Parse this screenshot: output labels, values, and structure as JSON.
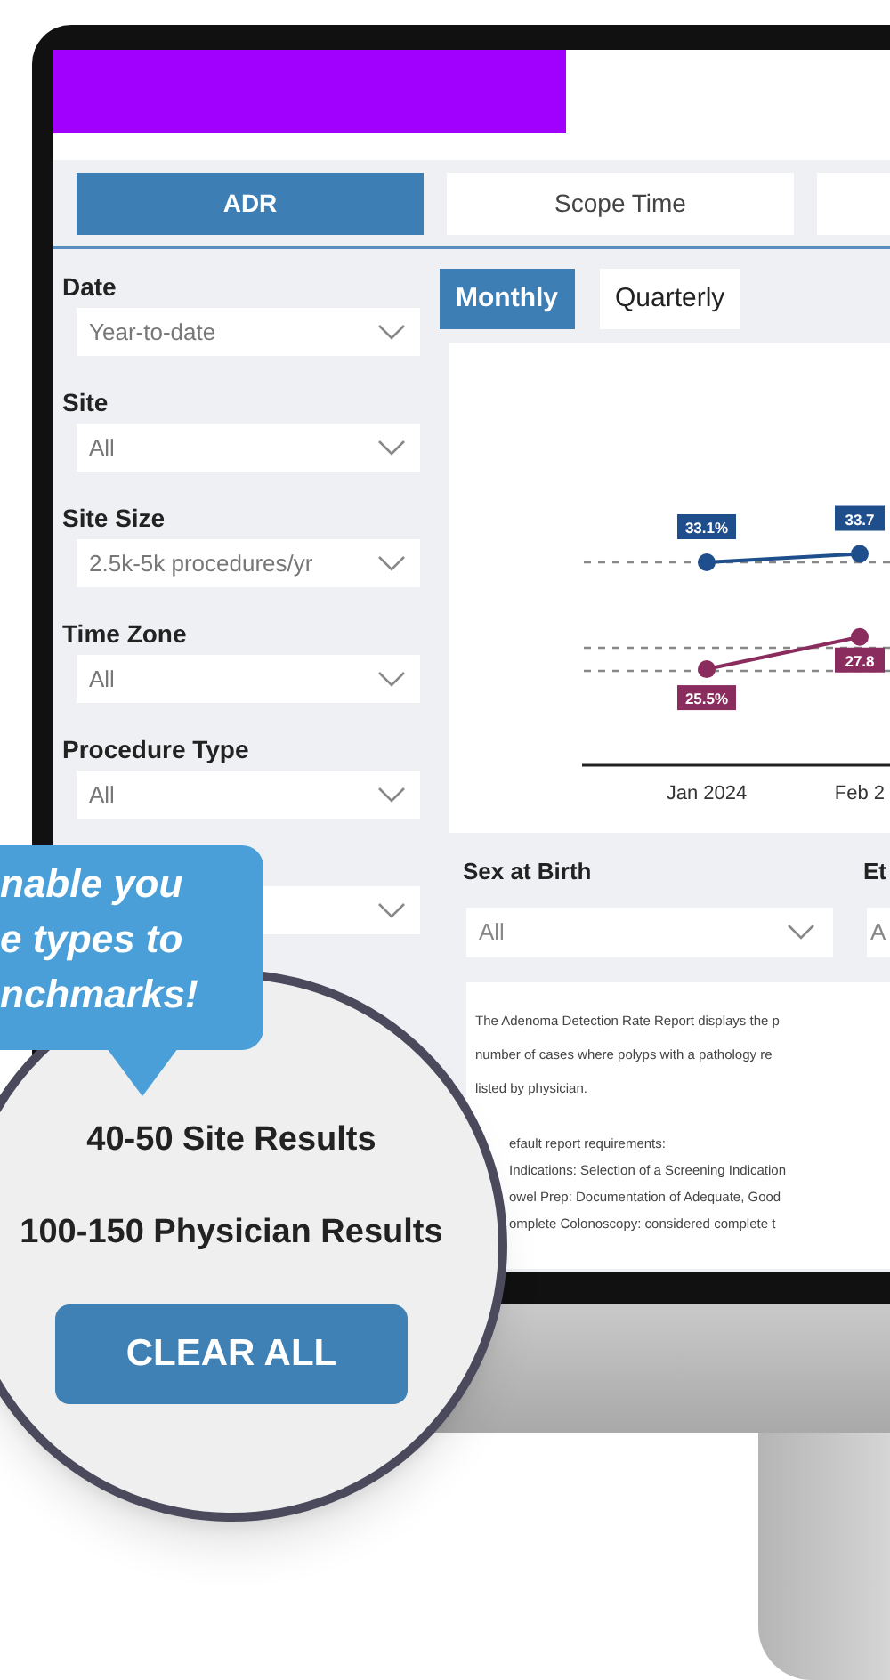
{
  "tabs": [
    {
      "label": "ADR",
      "selected": true
    },
    {
      "label": "Scope Time",
      "selected": false
    }
  ],
  "filters": [
    {
      "label": "Date",
      "value": "Year-to-date"
    },
    {
      "label": "Site",
      "value": "All"
    },
    {
      "label": "Site Size",
      "value": "2.5k-5k procedures/yr"
    },
    {
      "label": "Time Zone",
      "value": "All"
    },
    {
      "label": "Procedure Type",
      "value": "All"
    }
  ],
  "period_toggle": [
    {
      "label": "Monthly",
      "selected": true
    },
    {
      "label": "Quarterly",
      "selected": false
    }
  ],
  "chart_data": {
    "type": "line",
    "categories": [
      "Jan 2024",
      "Feb 2"
    ],
    "series": [
      {
        "color": "#1f4e8c",
        "marker": "circle",
        "values": [
          33.1,
          33.7
        ],
        "value_labels": [
          "33.1%",
          "33.7"
        ]
      },
      {
        "color": "#8b2c5f",
        "marker": "circle",
        "values": [
          25.5,
          27.8
        ],
        "value_labels": [
          "25.5%",
          "27.8"
        ]
      }
    ],
    "data_labels": true
  },
  "demographics": [
    {
      "label": "Sex at Birth",
      "value": "All"
    },
    {
      "label": "Et",
      "value": "A"
    }
  ],
  "description": {
    "paragraph": [
      "The Adenoma Detection Rate Report displays the p",
      "number of cases where polyps with a pathology re",
      "listed by physician."
    ],
    "requirements": [
      "efault report requirements:",
      "Indications:  Selection of a Screening Indication",
      "owel Prep: Documentation of Adequate, Good",
      "omplete Colonoscopy:  considered complete t"
    ]
  },
  "callout": {
    "lines": [
      "nable you",
      "e types to",
      "nchmarks!"
    ]
  },
  "results_card": {
    "lines": [
      "40-50 Site Results",
      "100-150 Physician Results"
    ],
    "button": "CLEAR ALL"
  }
}
